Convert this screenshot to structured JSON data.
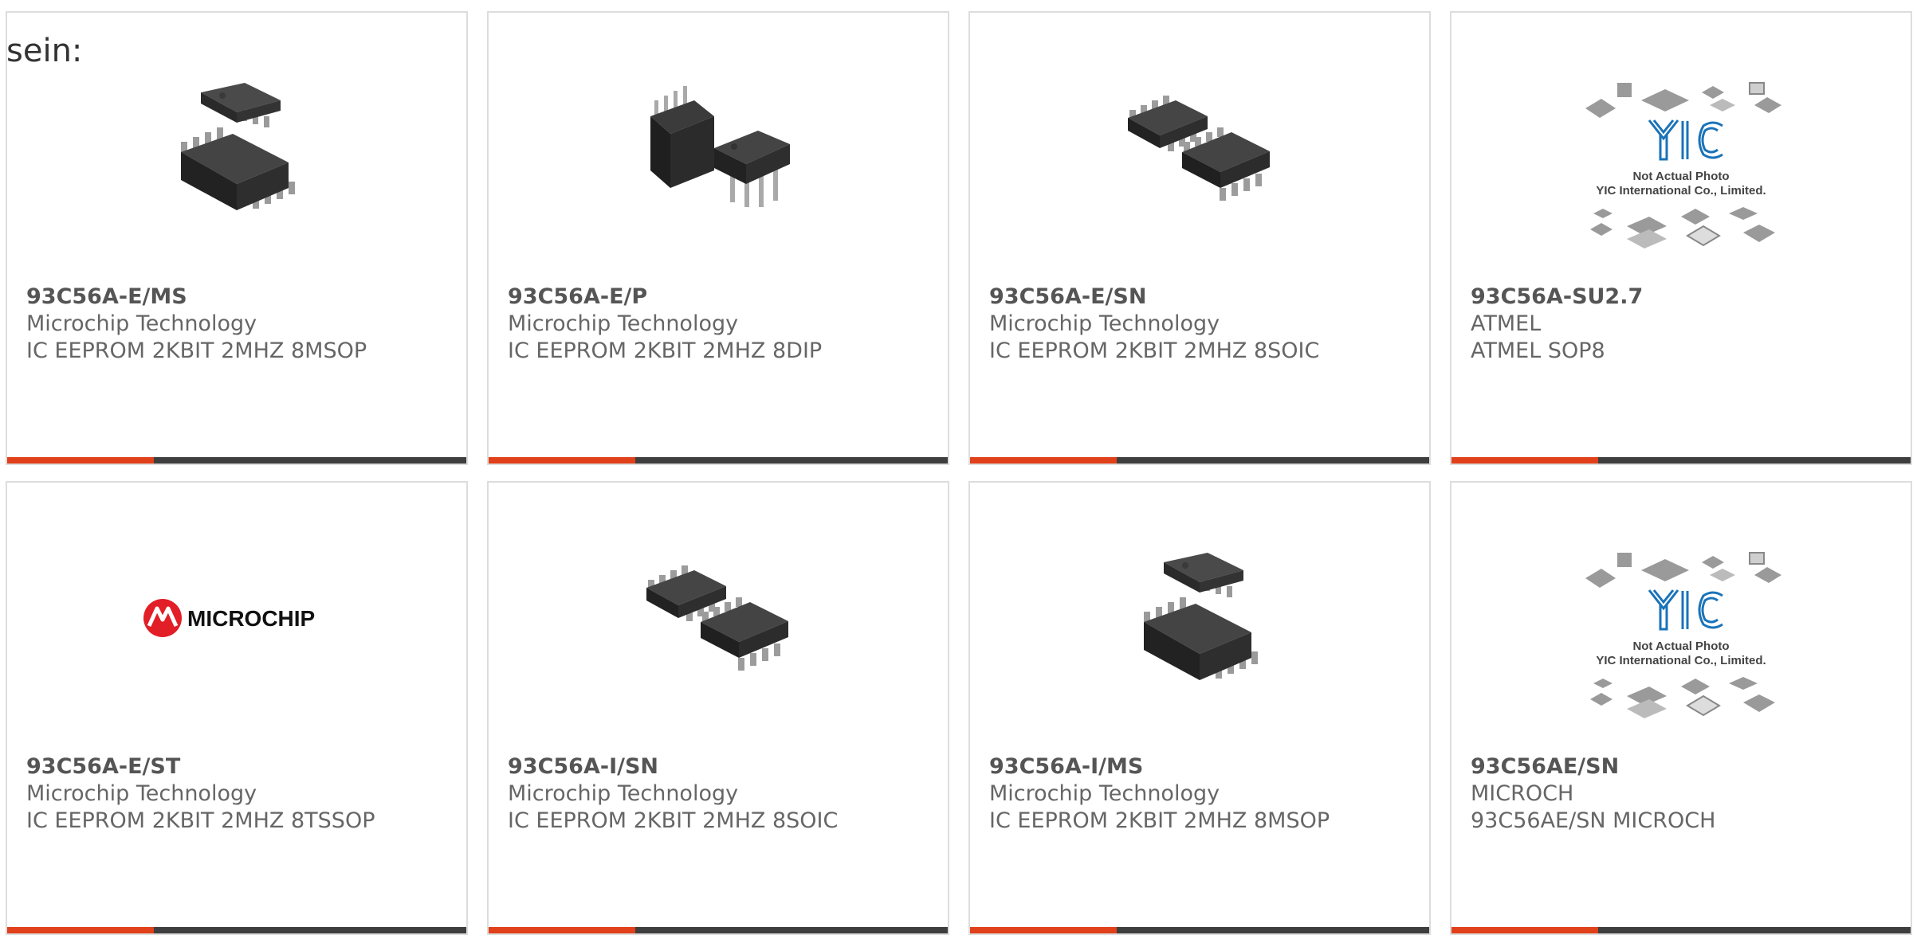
{
  "intro_text": "sein:",
  "colors": {
    "accent_bar": "#e0401a",
    "dark_bar": "#3e3e3e",
    "card_border": "#dddddd"
  },
  "products": [
    {
      "part": "93C56A-E/MS",
      "manufacturer": "Microchip Technology",
      "description": "IC EEPROM 2KBIT 2MHZ 8MSOP",
      "image": "msop-chip-image"
    },
    {
      "part": "93C56A-E/P",
      "manufacturer": "Microchip Technology",
      "description": "IC EEPROM 2KBIT 2MHZ 8DIP",
      "image": "dip-chip-image"
    },
    {
      "part": "93C56A-E/SN",
      "manufacturer": "Microchip Technology",
      "description": "IC EEPROM 2KBIT 2MHZ 8SOIC",
      "image": "soic-chip-image"
    },
    {
      "part": "93C56A-SU2.7",
      "manufacturer": "ATMEL",
      "description": "ATMEL SOP8",
      "image": "yic-placeholder-image",
      "image_caption": [
        "Not Actual Photo",
        "YIC International Co., Limited."
      ]
    },
    {
      "part": "93C56A-E/ST",
      "manufacturer": "Microchip Technology",
      "description": "IC EEPROM 2KBIT 2MHZ 8TSSOP",
      "image": "microchip-logo-image",
      "logo_text": "MICROCHIP"
    },
    {
      "part": "93C56A-I/SN",
      "manufacturer": "Microchip Technology",
      "description": "IC EEPROM 2KBIT 2MHZ 8SOIC",
      "image": "soic-chip-image"
    },
    {
      "part": "93C56A-I/MS",
      "manufacturer": "Microchip Technology",
      "description": "IC EEPROM 2KBIT 2MHZ 8MSOP",
      "image": "msop-chip-image"
    },
    {
      "part": "93C56AE/SN",
      "manufacturer": "MICROCH",
      "description": "93C56AE/SN MICROCH",
      "image": "yic-placeholder-image",
      "image_caption": [
        "Not Actual Photo",
        "YIC International Co., Limited."
      ]
    }
  ]
}
